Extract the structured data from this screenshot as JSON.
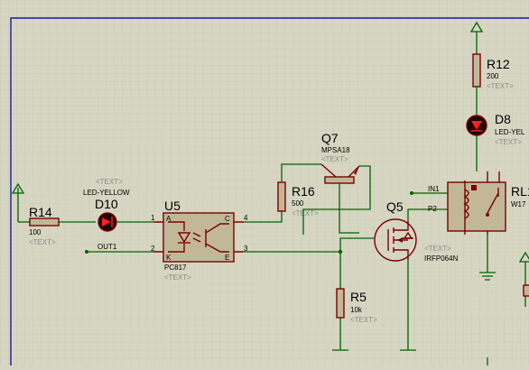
{
  "components": {
    "r14": {
      "ref": "R14",
      "value": "100",
      "text": "<TEXT>"
    },
    "d10": {
      "ref": "D10",
      "type": "LED-YELLOW",
      "text": "<TEXT>"
    },
    "u5": {
      "ref": "U5",
      "part": "PC817",
      "text": "<TEXT>",
      "pin_a": "A",
      "pin_k": "K",
      "pin_c": "C",
      "pin_e": "E",
      "pin1": "1",
      "pin2": "2",
      "pin3": "3",
      "pin4": "4"
    },
    "q7": {
      "ref": "Q7",
      "part": "MPSA18",
      "text": "<TEXT>"
    },
    "r16": {
      "ref": "R16",
      "value": "500",
      "text": "<TEXT>"
    },
    "q5": {
      "ref": "Q5",
      "part": "IRFP064N",
      "text": "<TEXT>"
    },
    "r5": {
      "ref": "R5",
      "value": "10k",
      "text": "<TEXT>"
    },
    "r12": {
      "ref": "R12",
      "value": "200",
      "text": "<TEXT>"
    },
    "d8": {
      "ref": "D8",
      "type": "LED-YEL",
      "text": "<TEXT>"
    },
    "rl1": {
      "ref": "RL1",
      "part": "W17",
      "pin_in1": "IN1",
      "pin_p2": "P2"
    }
  },
  "nets": {
    "out1": "OUT1"
  },
  "colors": {
    "background": "#d6d6c3",
    "grid": "#c4c4ae",
    "wire": "#006400",
    "component_outline": "#7a0000",
    "component_fill": "#c2b898",
    "text_placeholder": "#8a8a8a",
    "border": "#1a1aa0"
  }
}
